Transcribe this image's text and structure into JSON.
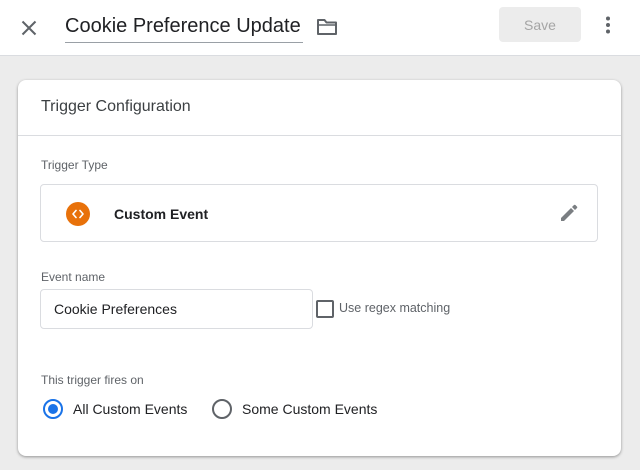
{
  "topbar": {
    "title": "Cookie Preference Update",
    "save_label": "Save"
  },
  "card": {
    "title": "Trigger Configuration",
    "trigger_type_label": "Trigger Type",
    "trigger_type": {
      "name": "Custom Event",
      "icon": "code-brackets-icon",
      "icon_color": "#e8710a"
    },
    "event_name_label": "Event name",
    "event_name_value": "Cookie Preferences",
    "regex_label": "Use regex matching",
    "regex_checked": false,
    "fires_on_label": "This trigger fires on",
    "fires_on_options": [
      {
        "label": "All Custom Events",
        "selected": true
      },
      {
        "label": "Some Custom Events",
        "selected": false
      }
    ]
  },
  "colors": {
    "accent": "#1a73e8",
    "background": "#ececec"
  }
}
